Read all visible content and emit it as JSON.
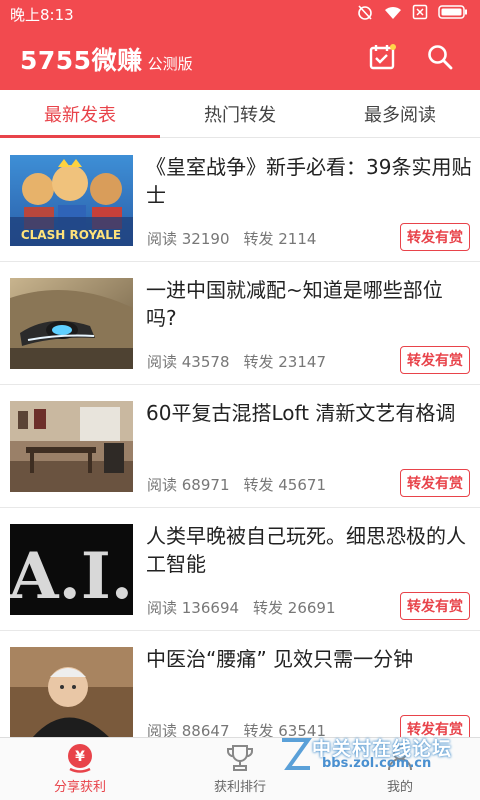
{
  "status": {
    "time": "晚上8:13"
  },
  "app": {
    "name": "5755微赚",
    "subtitle": "公测版"
  },
  "tabs": [
    {
      "label": "最新发表",
      "active": true
    },
    {
      "label": "热门转发",
      "active": false
    },
    {
      "label": "最多阅读",
      "active": false
    }
  ],
  "articles": [
    {
      "title": "《皇室战争》新手必看：39条实用贴士",
      "read": "阅读 32190",
      "share": "转发 2114",
      "badge": "转发有赏",
      "thumb_text": "CLASH ROYALE"
    },
    {
      "title": "一进中国就减配~知道是哪些部位吗?",
      "read": "阅读 43578",
      "share": "转发 23147",
      "badge": "转发有赏"
    },
    {
      "title": "60平复古混搭Loft 清新文艺有格调",
      "read": "阅读 68971",
      "share": "转发 45671",
      "badge": "转发有赏"
    },
    {
      "title": "人类早晚被自己玩死。细思恐极的人工智能",
      "read": "阅读 136694",
      "share": "转发 26691",
      "badge": "转发有赏",
      "thumb_text": "A.I."
    },
    {
      "title": "中医治“腰痛” 见效只需一分钟",
      "read": "阅读 88647",
      "share": "转发 63541",
      "badge": "转发有赏"
    }
  ],
  "bottom_nav": [
    {
      "label": "分享获利",
      "icon": "yuan-share-icon",
      "active": true
    },
    {
      "label": "获利排行",
      "icon": "trophy-icon",
      "active": false
    },
    {
      "label": "我的",
      "icon": "user-icon",
      "active": false
    }
  ],
  "watermark": {
    "main": "中关村在线论坛",
    "sub": "bbs.zol.com.cn"
  },
  "colors": {
    "brand_red": "#f24a4f",
    "accent_red": "#e8434a"
  }
}
